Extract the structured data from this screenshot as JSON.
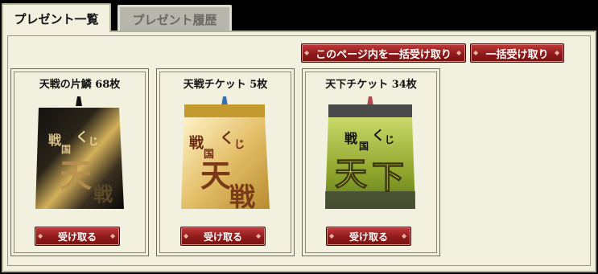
{
  "tabs": [
    {
      "label": "プレゼント一覧",
      "active": true
    },
    {
      "label": "プレゼント履歴",
      "active": false
    }
  ],
  "actions": {
    "receive_page_all_label": "このページ内を一括受け取り",
    "receive_all_label": "一括受け取り"
  },
  "presents": [
    {
      "title": "天戦の片鱗 68枚",
      "image": "gacha-ticket-black-gold-icon",
      "receive_label": "受け取る"
    },
    {
      "title": "天戦チケット 5枚",
      "image": "gacha-ticket-gold-icon",
      "receive_label": "受け取る"
    },
    {
      "title": "天下チケット 34枚",
      "image": "gacha-ticket-green-icon",
      "receive_label": "受け取る"
    }
  ],
  "ticket_art": {
    "logo_chars": [
      "戦",
      "国",
      "く",
      "じ"
    ],
    "tenkai": [
      "天",
      "戦"
    ],
    "tenka": [
      "天",
      "下"
    ]
  },
  "colors": {
    "panel_bg": "#f2f0de",
    "button_red": "#8e1a1a",
    "gold": "#d4a93c",
    "green": "#8fa52c"
  }
}
